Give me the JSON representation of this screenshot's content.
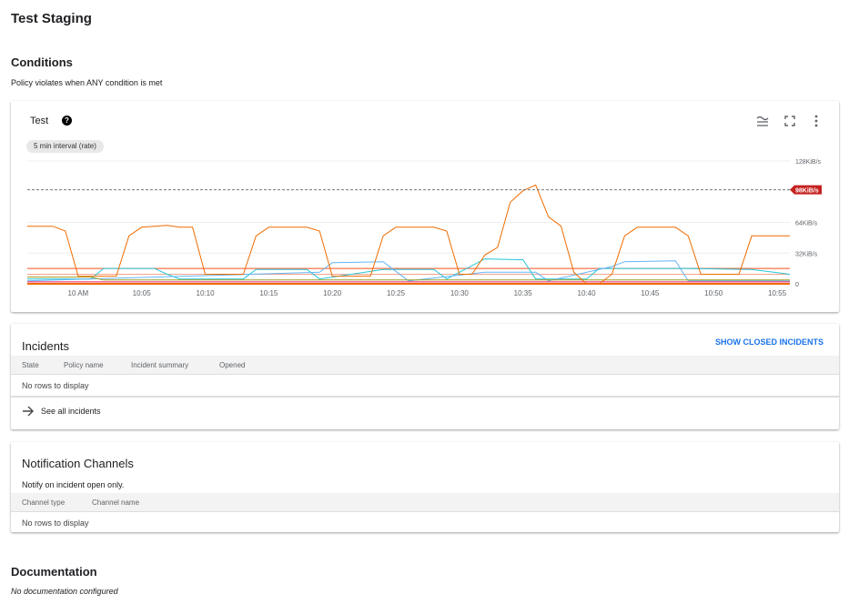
{
  "page_title": "Test Staging",
  "conditions": {
    "heading": "Conditions",
    "description": "Policy violates when ANY condition is met"
  },
  "chart_card": {
    "title": "Test",
    "help_icon": "help-icon",
    "icons": [
      "legend-toggle-icon",
      "fullscreen-icon",
      "more-vert-icon"
    ],
    "interval_chip": "5 min interval (rate)"
  },
  "chart_data": {
    "type": "line",
    "ylabels": [
      "128KiB/s",
      "64KiB/s",
      "32KiB/s",
      "0"
    ],
    "yticks": [
      128,
      64,
      32,
      0
    ],
    "ylim": [
      0,
      128
    ],
    "xticks": [
      "10 AM",
      "10:05",
      "10:10",
      "10:15",
      "10:20",
      "10:25",
      "10:30",
      "10:35",
      "10:40",
      "10:45",
      "10:50",
      "10:55"
    ],
    "xtick_times": [
      "10:00",
      "10:05",
      "10:10",
      "10:15",
      "10:20",
      "10:25",
      "10:30",
      "10:35",
      "10:40",
      "10:45",
      "10:50",
      "10:55"
    ],
    "xlim": [
      "09:56",
      "10:56"
    ],
    "threshold": {
      "value": 98,
      "label": "98KiB/s",
      "color": "#c5221f"
    },
    "grid": true,
    "series": [
      {
        "color": "#f4511e",
        "values": [
          [
            "09:56",
            16
          ],
          [
            "10:56",
            16
          ]
        ]
      },
      {
        "color": "#f6a38c",
        "values": [
          [
            "09:56",
            10
          ],
          [
            "10:56",
            10
          ]
        ]
      },
      {
        "color": "#26c6da",
        "values": [
          [
            "09:56",
            5
          ],
          [
            "10:01",
            5
          ],
          [
            "10:02",
            16
          ],
          [
            "10:06",
            16
          ],
          [
            "10:07",
            10
          ],
          [
            "10:08",
            5
          ],
          [
            "10:13",
            5
          ],
          [
            "10:14",
            15
          ],
          [
            "10:18",
            15
          ],
          [
            "10:19",
            5
          ],
          [
            "10:24",
            15
          ],
          [
            "10:28",
            15
          ],
          [
            "10:29",
            5
          ],
          [
            "10:32",
            26
          ],
          [
            "10:35",
            25
          ],
          [
            "10:36",
            5
          ],
          [
            "10:40",
            5
          ],
          [
            "10:41",
            16
          ],
          [
            "10:48",
            16
          ],
          [
            "10:53",
            15
          ],
          [
            "10:56",
            10
          ]
        ]
      },
      {
        "color": "#64b5f6",
        "values": [
          [
            "09:56",
            3
          ],
          [
            "10:19",
            12
          ],
          [
            "10:20",
            22
          ],
          [
            "10:24",
            23
          ],
          [
            "10:25",
            13
          ],
          [
            "10:26",
            3
          ],
          [
            "10:32",
            12
          ],
          [
            "10:36",
            12
          ],
          [
            "10:37",
            3
          ],
          [
            "10:42",
            18
          ],
          [
            "10:43",
            23
          ],
          [
            "10:47",
            24
          ],
          [
            "10:48",
            3
          ],
          [
            "10:56",
            3
          ]
        ]
      },
      {
        "color": "#e91e63",
        "values": [
          [
            "09:56",
            2
          ],
          [
            "10:56",
            2
          ]
        ]
      },
      {
        "color": "#9e9d24",
        "values": [
          [
            "09:56",
            7
          ],
          [
            "10:01",
            7
          ],
          [
            "10:02",
            4
          ],
          [
            "10:56",
            4
          ]
        ]
      },
      {
        "color": "#ef6c00",
        "values": [
          [
            "09:56",
            60
          ],
          [
            "09:58",
            60
          ],
          [
            "09:59",
            55
          ],
          [
            "10:00",
            8
          ],
          [
            "10:03",
            8
          ],
          [
            "10:04",
            50
          ],
          [
            "10:05",
            59
          ],
          [
            "10:07",
            61
          ],
          [
            "10:08",
            59
          ],
          [
            "10:09",
            59
          ],
          [
            "10:10",
            10
          ],
          [
            "10:13",
            10
          ],
          [
            "10:14",
            50
          ],
          [
            "10:15",
            59
          ],
          [
            "10:18",
            59
          ],
          [
            "10:19",
            55
          ],
          [
            "10:20",
            8
          ],
          [
            "10:23",
            8
          ],
          [
            "10:24",
            50
          ],
          [
            "10:25",
            59
          ],
          [
            "10:28",
            59
          ],
          [
            "10:29",
            55
          ],
          [
            "10:30",
            10
          ],
          [
            "10:31",
            10
          ],
          [
            "10:32",
            30
          ],
          [
            "10:33",
            38
          ],
          [
            "10:34",
            85
          ],
          [
            "10:35",
            97
          ],
          [
            "10:36",
            103
          ],
          [
            "10:37",
            70
          ],
          [
            "10:38",
            60
          ],
          [
            "10:39",
            12
          ],
          [
            "10:40",
            0
          ],
          [
            "10:41",
            0
          ],
          [
            "10:42",
            10
          ],
          [
            "10:43",
            50
          ],
          [
            "10:44",
            59
          ],
          [
            "10:47",
            59
          ],
          [
            "10:48",
            50
          ],
          [
            "10:49",
            10
          ],
          [
            "10:52",
            10
          ],
          [
            "10:53",
            50
          ],
          [
            "10:56",
            50
          ]
        ]
      }
    ]
  },
  "incidents": {
    "title": "Incidents",
    "show_closed": "SHOW CLOSED INCIDENTS",
    "columns": [
      "State",
      "Policy name",
      "Incident summary",
      "Opened"
    ],
    "empty": "No rows to display",
    "see_all": "See all incidents"
  },
  "notifications": {
    "title": "Notification Channels",
    "description": "Notify on incident open only.",
    "columns": [
      "Channel type",
      "Channel name"
    ],
    "empty": "No rows to display"
  },
  "documentation": {
    "heading": "Documentation",
    "text": "No documentation configured"
  }
}
